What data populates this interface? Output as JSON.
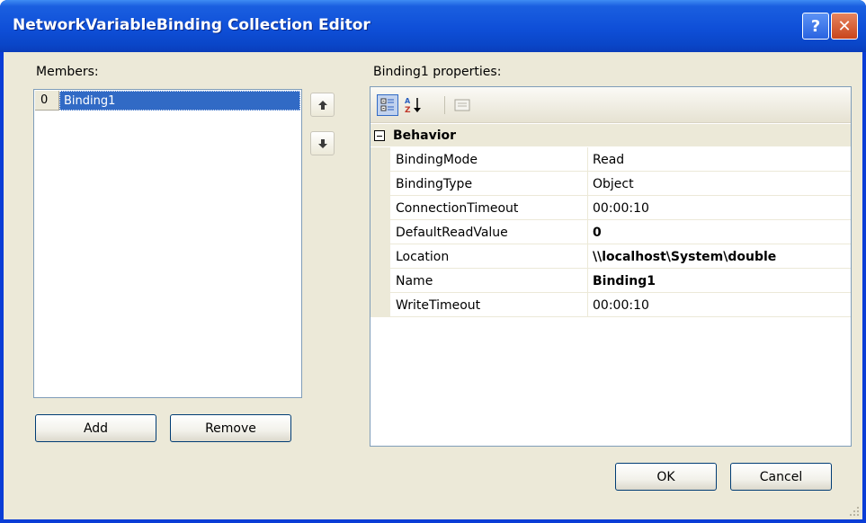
{
  "window": {
    "title": "NetworkVariableBinding Collection Editor",
    "help_glyph": "?",
    "close_glyph": "✕",
    "accent_color": "#0a46c8"
  },
  "members": {
    "label": "Members:",
    "items": [
      {
        "index": "0",
        "name": "Binding1",
        "selected": true
      }
    ],
    "up_icon": "up-arrow-icon",
    "down_icon": "down-arrow-icon",
    "add_label": "Add",
    "remove_label": "Remove"
  },
  "properties": {
    "label": "Binding1 properties:",
    "toolbar_icons": [
      "categorized-icon",
      "alphabetical-sort-icon",
      "property-pages-icon"
    ],
    "category": "Behavior",
    "rows": [
      {
        "name": "BindingMode",
        "value": "Read",
        "bold": false
      },
      {
        "name": "BindingType",
        "value": "Object",
        "bold": false
      },
      {
        "name": "ConnectionTimeout",
        "value": "00:00:10",
        "bold": false
      },
      {
        "name": "DefaultReadValue",
        "value": "0",
        "bold": true
      },
      {
        "name": "Location",
        "value": "\\\\localhost\\System\\double",
        "bold": true
      },
      {
        "name": "Name",
        "value": "Binding1",
        "bold": true
      },
      {
        "name": "WriteTimeout",
        "value": "00:00:10",
        "bold": false
      }
    ]
  },
  "footer": {
    "ok_label": "OK",
    "cancel_label": "Cancel"
  }
}
